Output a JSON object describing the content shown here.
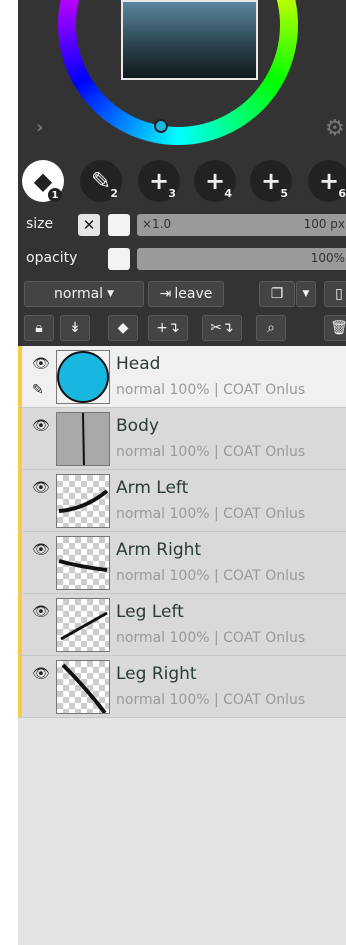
{
  "color_picker": {
    "hue_color": "#19b6e0",
    "square_color": "#3b5f72"
  },
  "brushes": [
    {
      "icon": "eraser-icon",
      "number": "1",
      "selected": true
    },
    {
      "icon": "pencil-icon",
      "number": "2",
      "selected": false
    },
    {
      "icon": "plus-icon",
      "number": "3",
      "selected": false
    },
    {
      "icon": "plus-icon",
      "number": "4",
      "selected": false
    },
    {
      "icon": "plus-icon",
      "number": "5",
      "selected": false
    },
    {
      "icon": "plus-icon",
      "number": "6",
      "selected": false
    }
  ],
  "size": {
    "label": "size",
    "multiplier": "×1.0",
    "value": "100 px"
  },
  "opacity": {
    "label": "opacity",
    "value": "100%"
  },
  "toolbar": {
    "blend_mode": "normal",
    "leave_label": "leave"
  },
  "layers": [
    {
      "name": "Head",
      "info": "normal 100% | COAT Onlus",
      "active": true
    },
    {
      "name": "Body",
      "info": "normal 100% | COAT Onlus",
      "active": false
    },
    {
      "name": "Arm Left",
      "info": "normal 100% | COAT Onlus",
      "active": false
    },
    {
      "name": "Arm Right",
      "info": "normal 100% | COAT Onlus",
      "active": false
    },
    {
      "name": "Leg Left",
      "info": "normal 100% | COAT Onlus",
      "active": false
    },
    {
      "name": "Leg Right",
      "info": "normal 100% | COAT Onlus",
      "active": false
    }
  ],
  "colors": {
    "accent": "#f5cc43",
    "panel": "#333333",
    "head_fill": "#19b6e0"
  }
}
